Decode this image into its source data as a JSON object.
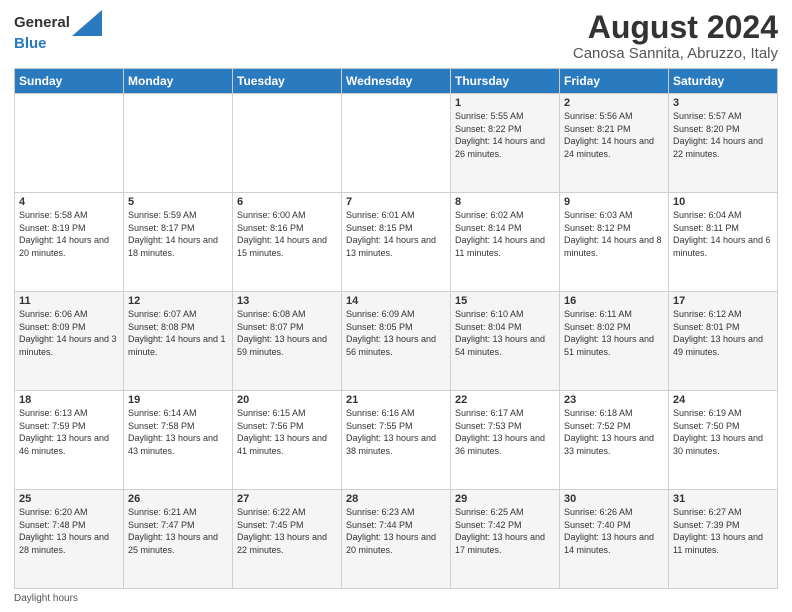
{
  "logo": {
    "line1": "General",
    "line2": "Blue"
  },
  "title": "August 2024",
  "subtitle": "Canosa Sannita, Abruzzo, Italy",
  "days_of_week": [
    "Sunday",
    "Monday",
    "Tuesday",
    "Wednesday",
    "Thursday",
    "Friday",
    "Saturday"
  ],
  "footer": "Daylight hours",
  "weeks": [
    [
      {
        "date": "",
        "info": ""
      },
      {
        "date": "",
        "info": ""
      },
      {
        "date": "",
        "info": ""
      },
      {
        "date": "",
        "info": ""
      },
      {
        "date": "1",
        "info": "Sunrise: 5:55 AM\nSunset: 8:22 PM\nDaylight: 14 hours and 26 minutes."
      },
      {
        "date": "2",
        "info": "Sunrise: 5:56 AM\nSunset: 8:21 PM\nDaylight: 14 hours and 24 minutes."
      },
      {
        "date": "3",
        "info": "Sunrise: 5:57 AM\nSunset: 8:20 PM\nDaylight: 14 hours and 22 minutes."
      }
    ],
    [
      {
        "date": "4",
        "info": "Sunrise: 5:58 AM\nSunset: 8:19 PM\nDaylight: 14 hours and 20 minutes."
      },
      {
        "date": "5",
        "info": "Sunrise: 5:59 AM\nSunset: 8:17 PM\nDaylight: 14 hours and 18 minutes."
      },
      {
        "date": "6",
        "info": "Sunrise: 6:00 AM\nSunset: 8:16 PM\nDaylight: 14 hours and 15 minutes."
      },
      {
        "date": "7",
        "info": "Sunrise: 6:01 AM\nSunset: 8:15 PM\nDaylight: 14 hours and 13 minutes."
      },
      {
        "date": "8",
        "info": "Sunrise: 6:02 AM\nSunset: 8:14 PM\nDaylight: 14 hours and 11 minutes."
      },
      {
        "date": "9",
        "info": "Sunrise: 6:03 AM\nSunset: 8:12 PM\nDaylight: 14 hours and 8 minutes."
      },
      {
        "date": "10",
        "info": "Sunrise: 6:04 AM\nSunset: 8:11 PM\nDaylight: 14 hours and 6 minutes."
      }
    ],
    [
      {
        "date": "11",
        "info": "Sunrise: 6:06 AM\nSunset: 8:09 PM\nDaylight: 14 hours and 3 minutes."
      },
      {
        "date": "12",
        "info": "Sunrise: 6:07 AM\nSunset: 8:08 PM\nDaylight: 14 hours and 1 minute."
      },
      {
        "date": "13",
        "info": "Sunrise: 6:08 AM\nSunset: 8:07 PM\nDaylight: 13 hours and 59 minutes."
      },
      {
        "date": "14",
        "info": "Sunrise: 6:09 AM\nSunset: 8:05 PM\nDaylight: 13 hours and 56 minutes."
      },
      {
        "date": "15",
        "info": "Sunrise: 6:10 AM\nSunset: 8:04 PM\nDaylight: 13 hours and 54 minutes."
      },
      {
        "date": "16",
        "info": "Sunrise: 6:11 AM\nSunset: 8:02 PM\nDaylight: 13 hours and 51 minutes."
      },
      {
        "date": "17",
        "info": "Sunrise: 6:12 AM\nSunset: 8:01 PM\nDaylight: 13 hours and 49 minutes."
      }
    ],
    [
      {
        "date": "18",
        "info": "Sunrise: 6:13 AM\nSunset: 7:59 PM\nDaylight: 13 hours and 46 minutes."
      },
      {
        "date": "19",
        "info": "Sunrise: 6:14 AM\nSunset: 7:58 PM\nDaylight: 13 hours and 43 minutes."
      },
      {
        "date": "20",
        "info": "Sunrise: 6:15 AM\nSunset: 7:56 PM\nDaylight: 13 hours and 41 minutes."
      },
      {
        "date": "21",
        "info": "Sunrise: 6:16 AM\nSunset: 7:55 PM\nDaylight: 13 hours and 38 minutes."
      },
      {
        "date": "22",
        "info": "Sunrise: 6:17 AM\nSunset: 7:53 PM\nDaylight: 13 hours and 36 minutes."
      },
      {
        "date": "23",
        "info": "Sunrise: 6:18 AM\nSunset: 7:52 PM\nDaylight: 13 hours and 33 minutes."
      },
      {
        "date": "24",
        "info": "Sunrise: 6:19 AM\nSunset: 7:50 PM\nDaylight: 13 hours and 30 minutes."
      }
    ],
    [
      {
        "date": "25",
        "info": "Sunrise: 6:20 AM\nSunset: 7:48 PM\nDaylight: 13 hours and 28 minutes."
      },
      {
        "date": "26",
        "info": "Sunrise: 6:21 AM\nSunset: 7:47 PM\nDaylight: 13 hours and 25 minutes."
      },
      {
        "date": "27",
        "info": "Sunrise: 6:22 AM\nSunset: 7:45 PM\nDaylight: 13 hours and 22 minutes."
      },
      {
        "date": "28",
        "info": "Sunrise: 6:23 AM\nSunset: 7:44 PM\nDaylight: 13 hours and 20 minutes."
      },
      {
        "date": "29",
        "info": "Sunrise: 6:25 AM\nSunset: 7:42 PM\nDaylight: 13 hours and 17 minutes."
      },
      {
        "date": "30",
        "info": "Sunrise: 6:26 AM\nSunset: 7:40 PM\nDaylight: 13 hours and 14 minutes."
      },
      {
        "date": "31",
        "info": "Sunrise: 6:27 AM\nSunset: 7:39 PM\nDaylight: 13 hours and 11 minutes."
      }
    ]
  ]
}
